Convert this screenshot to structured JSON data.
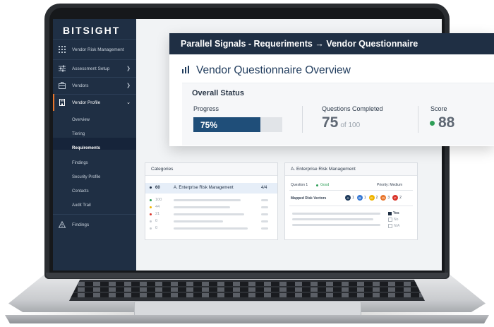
{
  "sidebar": {
    "logo": "BITSIGHT",
    "items": [
      {
        "label": "Vendor Risk Management",
        "icon": "grid-icon"
      },
      {
        "label": "Assessment Setup",
        "icon": "sliders-icon"
      },
      {
        "label": "Vendors",
        "icon": "briefcase-icon"
      },
      {
        "label": "Vendor Profile",
        "icon": "building-icon"
      }
    ],
    "sub_items": [
      "Overview",
      "Tiering",
      "Requirements",
      "Findings",
      "Security Profile",
      "Contacts",
      "Audit Trail"
    ],
    "bottom_item": {
      "label": "Findings",
      "icon": "warning-icon"
    }
  },
  "categories": {
    "title": "Categories",
    "selected": {
      "count": "60",
      "label": "A. Enterprise Risk Management",
      "fraction": "4/4"
    },
    "rows": [
      {
        "count": "100",
        "color": "#2e9e57"
      },
      {
        "count": "44",
        "color": "#f0b400"
      },
      {
        "count": "21",
        "color": "#d9342b"
      },
      {
        "count": "0",
        "color": "#c8ccd2"
      },
      {
        "count": "0",
        "color": "#c8ccd2"
      }
    ]
  },
  "question_panel": {
    "title": "A. Enterprise Risk Management",
    "question": "Question 1",
    "status": "Good",
    "priority": "Priority: Medium",
    "vectors_label": "Mapped Risk Vectors",
    "vectors": [
      {
        "letter": "A",
        "count": "1",
        "color": "#1f3b5c"
      },
      {
        "letter": "B",
        "count": "1",
        "color": "#3a7bd5"
      },
      {
        "letter": "C",
        "count": "2",
        "color": "#f0b400"
      },
      {
        "letter": "D",
        "count": "3",
        "color": "#e8762d"
      },
      {
        "letter": "F",
        "count": "2",
        "color": "#d9342b"
      }
    ],
    "options": [
      "Yes",
      "No",
      "N/A"
    ]
  },
  "overlay": {
    "header": "Parallel Signals - Requeriments → Vendor Questionnaire",
    "title": "Vendor Questionnaire Overview",
    "section": "Overall Status",
    "progress_label": "Progress",
    "progress_value": "75%",
    "progress_fraction": 0.75,
    "questions_label": "Questions Completed",
    "questions_value": "75",
    "questions_total": "of 100",
    "score_label": "Score",
    "score_value": "88"
  },
  "colors": {
    "navy": "#1f2f44",
    "accent": "#e8762d",
    "good": "#2e9e57",
    "progress": "#1f4e79"
  }
}
